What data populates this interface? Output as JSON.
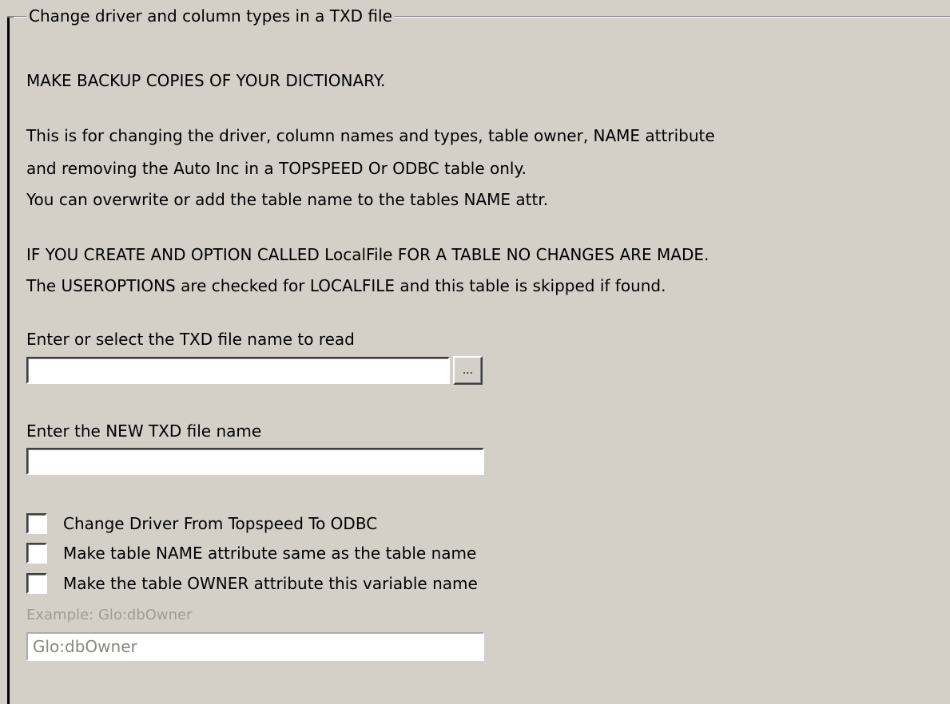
{
  "group": {
    "title": "Change driver and column types in a TXD file"
  },
  "instructions": {
    "backup_warning": "MAKE BACKUP COPIES OF YOUR DICTIONARY.",
    "desc_line1": "This is for changing the driver, column names and types, table owner, NAME attribute",
    "desc_line2": " and removing the Auto Inc in a TOPSPEED Or ODBC table only.",
    "desc_line3": " You can overwrite or add the table name to the tables NAME attr.",
    "localfile_line1": "IF YOU CREATE AND OPTION CALLED LocalFile FOR A TABLE NO CHANGES ARE MADE.",
    "localfile_line2": "The USEROPTIONS are checked for LOCALFILE and this table is skipped if found."
  },
  "read_file": {
    "label": "Enter or select the TXD file name to read",
    "value": "",
    "browse_label": "..."
  },
  "new_file": {
    "label": "Enter the NEW TXD file name",
    "value": ""
  },
  "options": [
    {
      "label": "Change Driver From Topspeed To ODBC",
      "checked": false
    },
    {
      "label": "Make table NAME attribute same as the table name",
      "checked": false
    },
    {
      "label": "Make the table OWNER attribute this variable name",
      "checked": false
    }
  ],
  "owner": {
    "example_label": "Example: Glo:dbOwner",
    "value": "Glo:dbOwner",
    "enabled": false
  }
}
